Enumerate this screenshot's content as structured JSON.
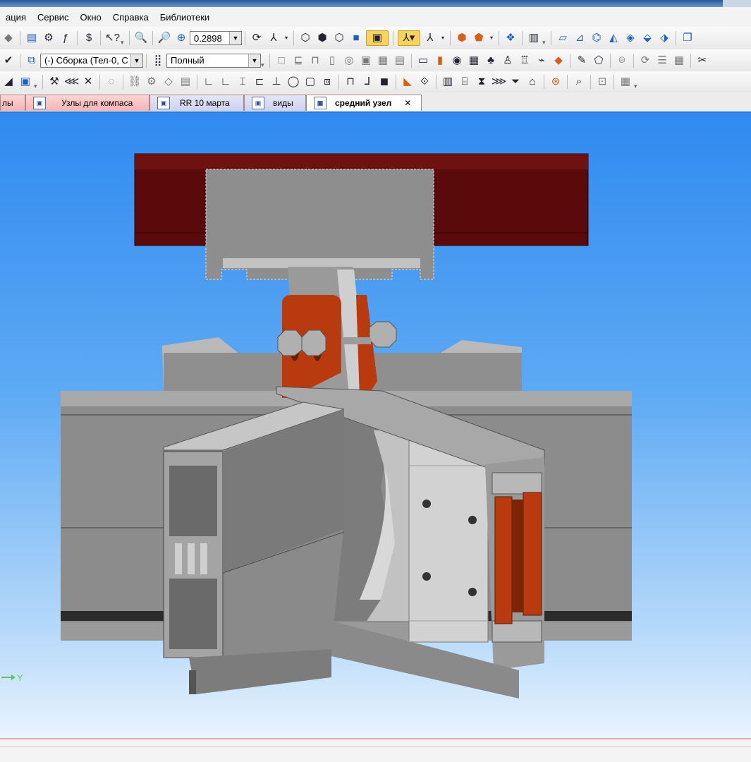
{
  "menu": [
    "ация",
    "Сервис",
    "Окно",
    "Справка",
    "Библиотеки"
  ],
  "toolbar1": {
    "zoom_value": "0.2898"
  },
  "toolbar2": {
    "assembly_combo": "(-) Сборка (Тел-0, С",
    "display_combo": "Полный"
  },
  "tabs": [
    {
      "label": "лы",
      "color": "pink"
    },
    {
      "label": "Узлы для компаса",
      "color": "pink"
    },
    {
      "label": "RR 10 марта",
      "color": "lavender"
    },
    {
      "label": "виды",
      "color": "lavender"
    },
    {
      "label": "средний узел",
      "color": "white",
      "active": true,
      "close": "✕"
    }
  ],
  "viewport": {
    "axis_label": "Y",
    "colors": {
      "background_top": "#2f8af0",
      "background_bottom": "#eaf4fe",
      "beam": "#5a0a0a",
      "plates": "#b83a0e",
      "profiles": "#8c8c8c"
    }
  }
}
